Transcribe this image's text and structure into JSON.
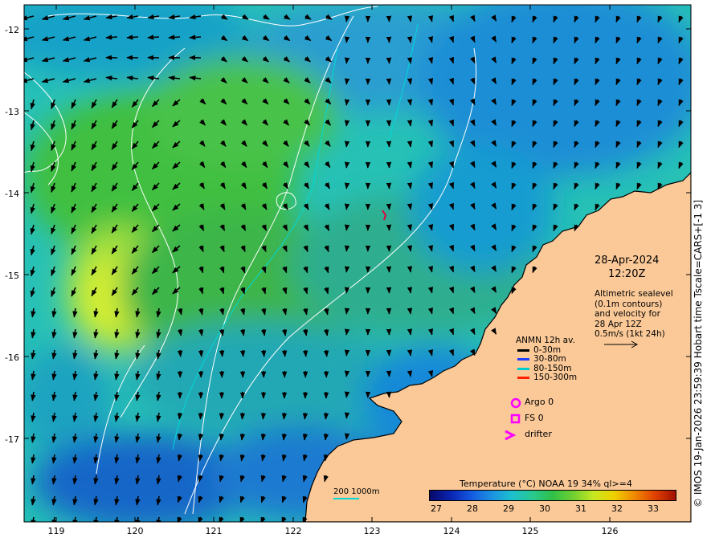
{
  "map": {
    "y_axis_labels": [
      "-12",
      "-13",
      "-14",
      "-15",
      "-16",
      "-17"
    ],
    "x_axis_labels": [
      "119",
      "120",
      "121",
      "122",
      "123",
      "124",
      "125",
      "126"
    ],
    "side_text": "© IMOS 19-Jan-2026 23:59:39 Hobart time Tscale=CARS+[-1 3]",
    "date_line1": "28-Apr-2024",
    "date_line2": "12:20Z",
    "altimetric": [
      "Altimetric sealevel",
      "(0.1m contours)",
      "and velocity for",
      "28 Apr 12Z",
      "0.5m/s (1kt 24h)"
    ],
    "legend_title": "ANMN 12h av.",
    "legend_items": [
      {
        "label": "0-30m",
        "color": "#000000"
      },
      {
        "label": "30-80m",
        "color": "#1f3cff"
      },
      {
        "label": "80-150m",
        "color": "#00cccc"
      },
      {
        "label": "150-300m",
        "color": "#ff2000"
      }
    ],
    "obs": [
      {
        "label": "Argo 0",
        "icon": "circle-icon",
        "color": "#ff00ff"
      },
      {
        "label": "FS 0",
        "icon": "square-icon",
        "color": "#ff00ff"
      },
      {
        "label": "drifter",
        "icon": "chevron-icon",
        "color": "#ff00ff"
      }
    ],
    "colorbar_title": "Temperature (°C) NOAA 19 34% ql>=4",
    "colorbar_ticks": [
      "27",
      "28",
      "29",
      "30",
      "31",
      "32",
      "33"
    ],
    "colorbar_range": [
      26.8,
      33.6
    ],
    "scale_label": "200  1000m",
    "colors": {
      "land": "#fbc998",
      "contour": "#ffffff",
      "bathy": "#00d8d8"
    }
  }
}
